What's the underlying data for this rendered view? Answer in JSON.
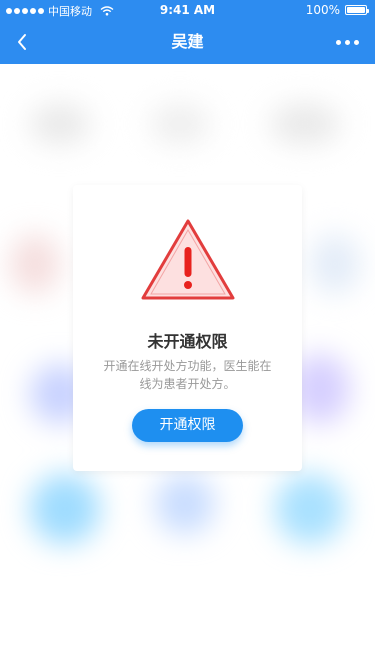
{
  "status_bar": {
    "carrier": "中国移动",
    "time": "9:41 AM",
    "battery": "100%"
  },
  "nav": {
    "title": "吴建"
  },
  "dialog": {
    "title": "未开通权限",
    "description": "开通在线开处方功能，医生能在线为患者开处方。",
    "button_label": "开通权限"
  },
  "colors": {
    "accent": "#2d8cf0",
    "button": "#1e8ff0",
    "warning_red": "#e23d3d"
  }
}
